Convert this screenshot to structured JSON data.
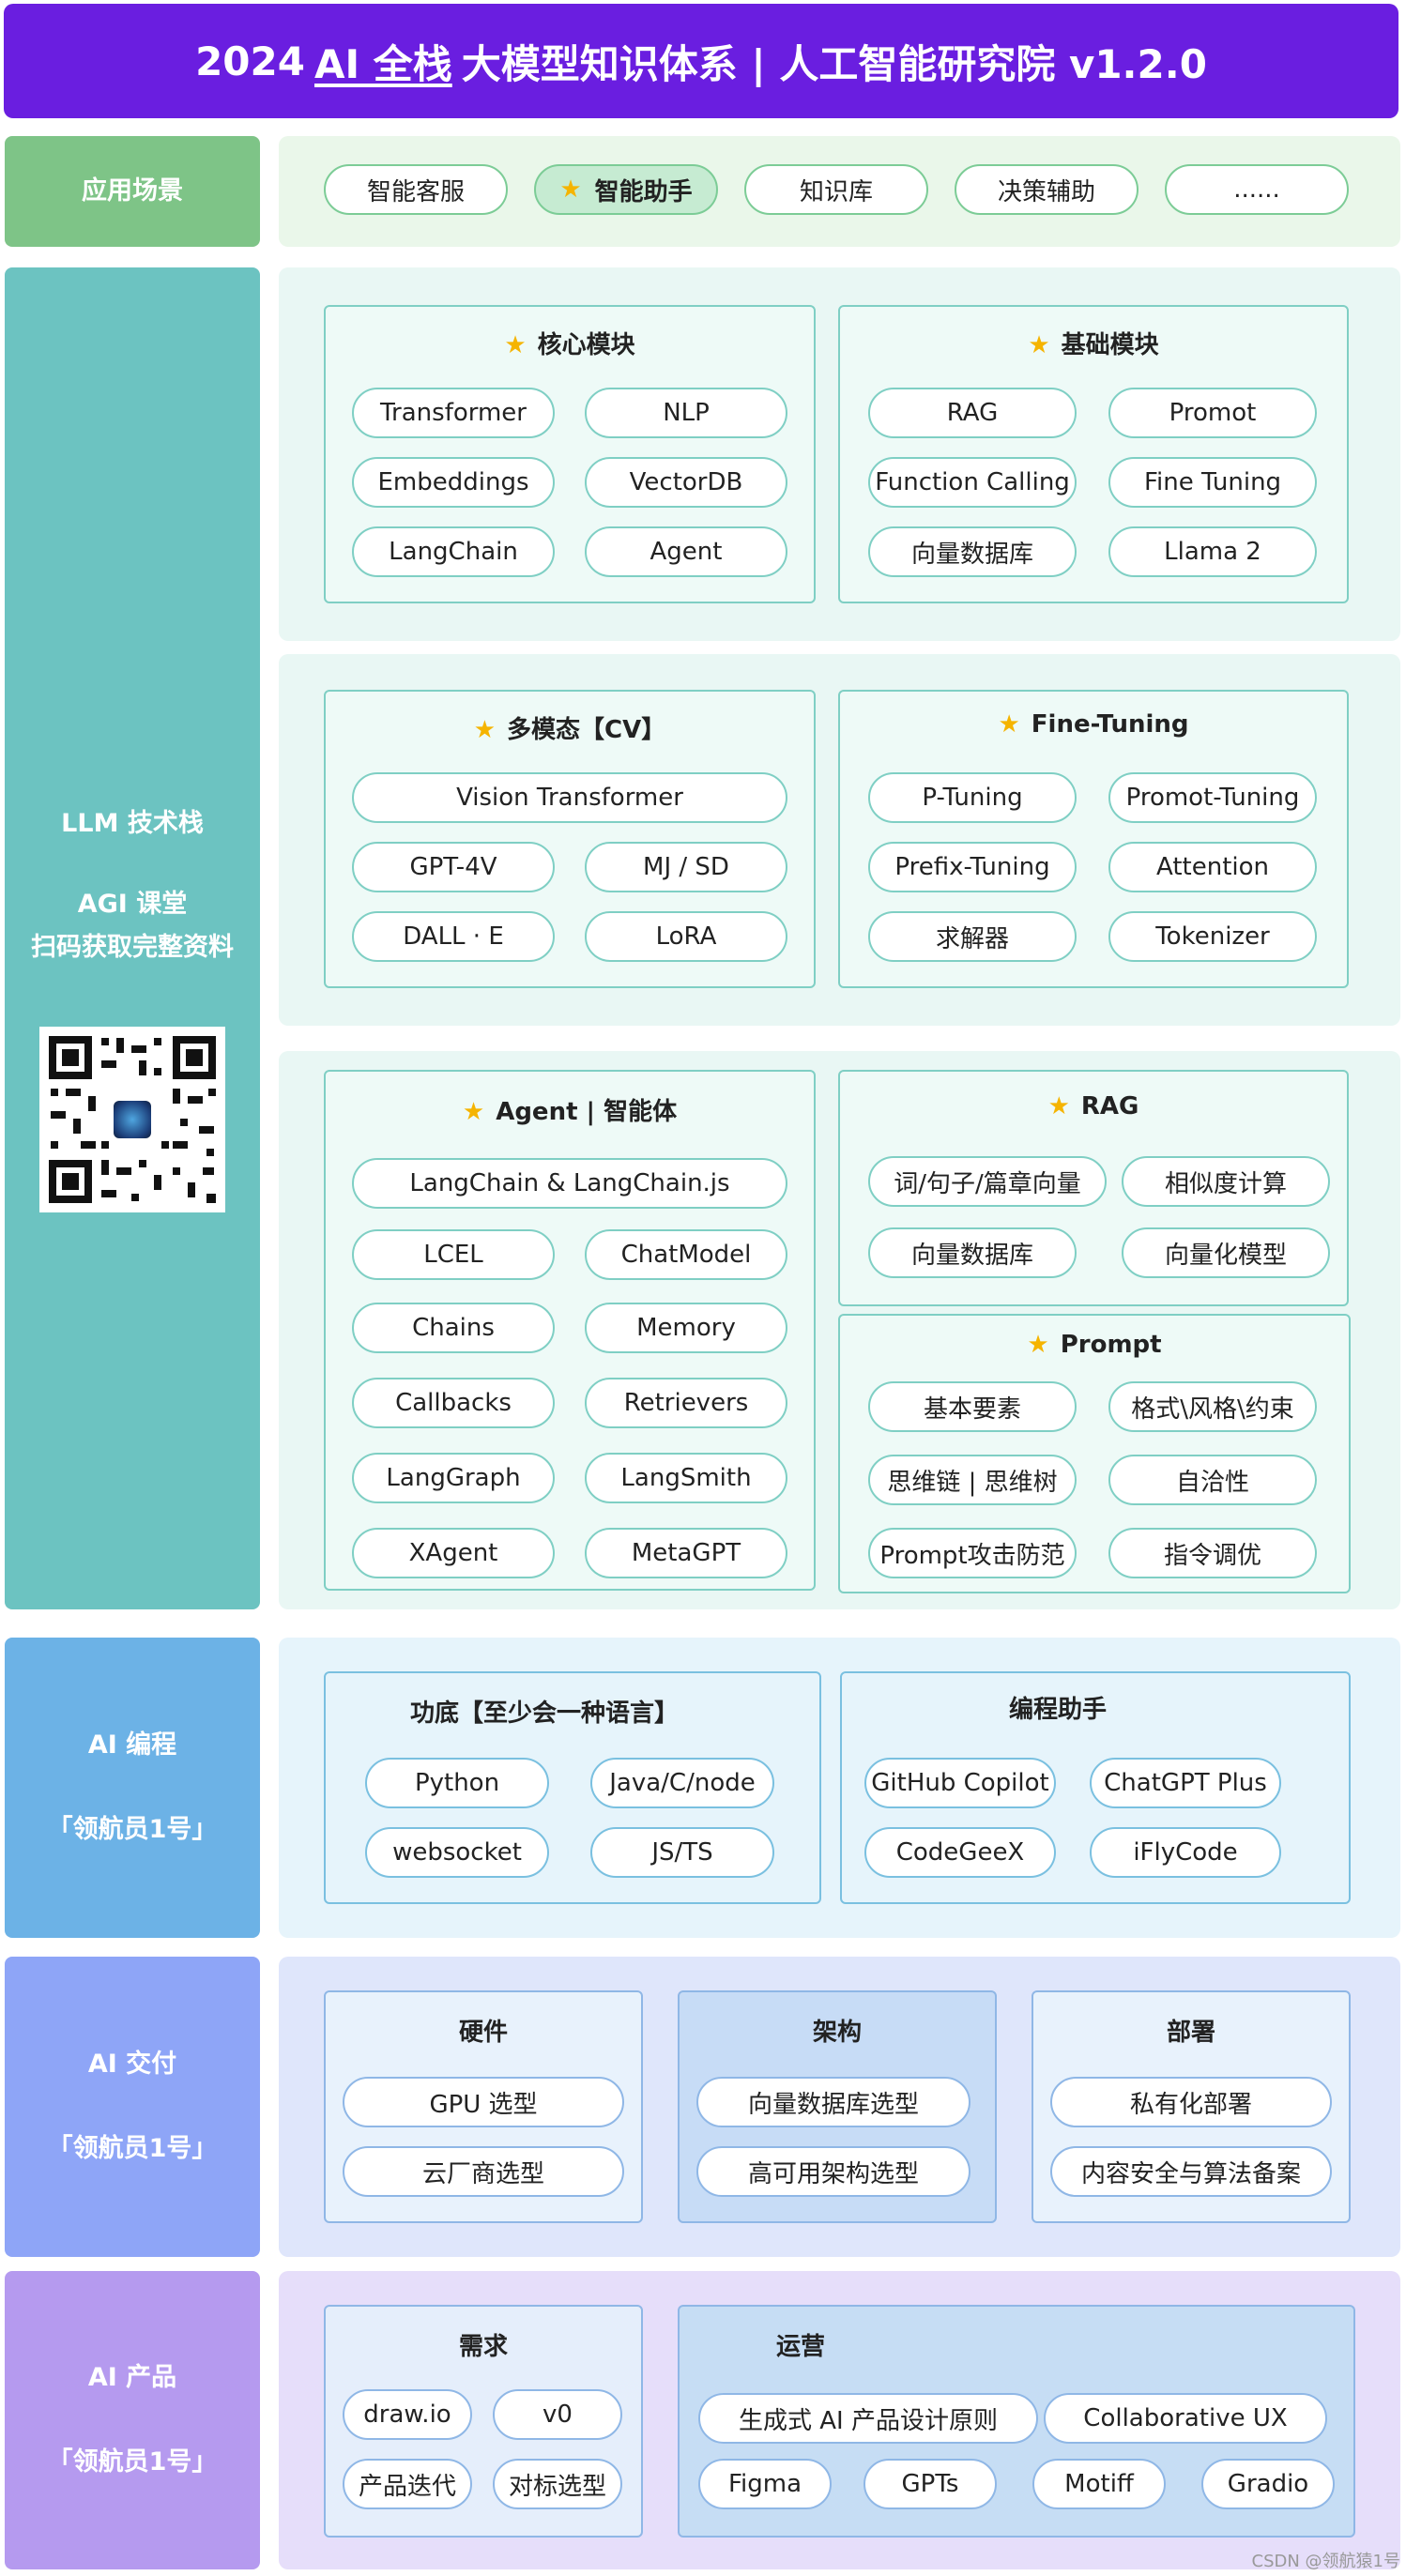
{
  "title": {
    "prefix": "2024",
    "highlight": "AI 全栈",
    "suffix": "大模型知识体系 | 人工智能研究院 v1.2.0"
  },
  "colors": {
    "title_bg": "#6a1ee0",
    "scene": "#7ec487",
    "llm": "#6cc3c1",
    "prog": "#6cb2e6",
    "deliver": "#8ea5f7",
    "product": "#b59aef"
  },
  "scenes": {
    "label": "应用场景",
    "items": [
      "智能客服",
      "智能助手",
      "知识库",
      "决策辅助",
      "......"
    ],
    "selected_icon": "star-icon"
  },
  "llm": {
    "label": "LLM 技术栈",
    "agi": "AGI 课堂",
    "qr_text": "扫码获取完整资料",
    "core": {
      "title": "核心模块",
      "items": [
        "Transformer",
        "NLP",
        "Embeddings",
        "VectorDB",
        "LangChain",
        "Agent"
      ]
    },
    "base": {
      "title": "基础模块",
      "items": [
        "RAG",
        "Promot",
        "Function Calling",
        "Fine Tuning",
        "向量数据库",
        "Llama 2"
      ]
    },
    "cv": {
      "title": "多模态【CV】",
      "items": [
        "Vision Transformer",
        "GPT-4V",
        "MJ / SD",
        "DALL · E",
        "LoRA"
      ]
    },
    "ft": {
      "title": "Fine-Tuning",
      "items": [
        "P-Tuning",
        "Promot-Tuning",
        "Prefix-Tuning",
        "Attention",
        "求解器",
        "Tokenizer"
      ]
    },
    "agent": {
      "title": "Agent | 智能体",
      "items": [
        "LangChain & LangChain.js",
        "LCEL",
        "ChatModel",
        "Chains",
        "Memory",
        "Callbacks",
        "Retrievers",
        "LangGraph",
        "LangSmith",
        "XAgent",
        "MetaGPT"
      ]
    },
    "rag": {
      "title": "RAG",
      "items": [
        "词/句子/篇章向量",
        "相似度计算",
        "向量数据库",
        "向量化模型"
      ]
    },
    "prompt": {
      "title": "Prompt",
      "items": [
        "基本要素",
        "格式\\风格\\约束",
        "思维链 | 思维树",
        "自洽性",
        "Prompt攻击防范",
        "指令调优"
      ]
    }
  },
  "prog": {
    "label": "AI 编程",
    "sub": "「领航员1号」",
    "basics": {
      "title": "功底【至少会一种语言】",
      "items": [
        "Python",
        "Java/C/node",
        "websocket",
        "JS/TS"
      ]
    },
    "assist": {
      "title": "编程助手",
      "items": [
        "GitHub Copilot",
        "ChatGPT Plus",
        "CodeGeeX",
        "iFlyCode"
      ]
    }
  },
  "deliver": {
    "label": "AI 交付",
    "sub": "「领航员1号」",
    "hw": {
      "title": "硬件",
      "items": [
        "GPU 选型",
        "云厂商选型"
      ]
    },
    "arch": {
      "title": "架构",
      "items": [
        "向量数据库选型",
        "高可用架构选型"
      ]
    },
    "deploy": {
      "title": "部署",
      "items": [
        "私有化部署",
        "内容安全与算法备案"
      ]
    }
  },
  "product": {
    "label": "AI 产品",
    "sub": "「领航员1号」",
    "req": {
      "title": "需求",
      "items": [
        "draw.io",
        "v0",
        "产品迭代",
        "对标选型"
      ]
    },
    "ops": {
      "title": "运营",
      "items": [
        "生成式 AI 产品设计原则",
        "Collaborative UX",
        "Figma",
        "GPTs",
        "Motiff",
        "Gradio"
      ]
    }
  },
  "footer": "CSDN @领航猿1号"
}
